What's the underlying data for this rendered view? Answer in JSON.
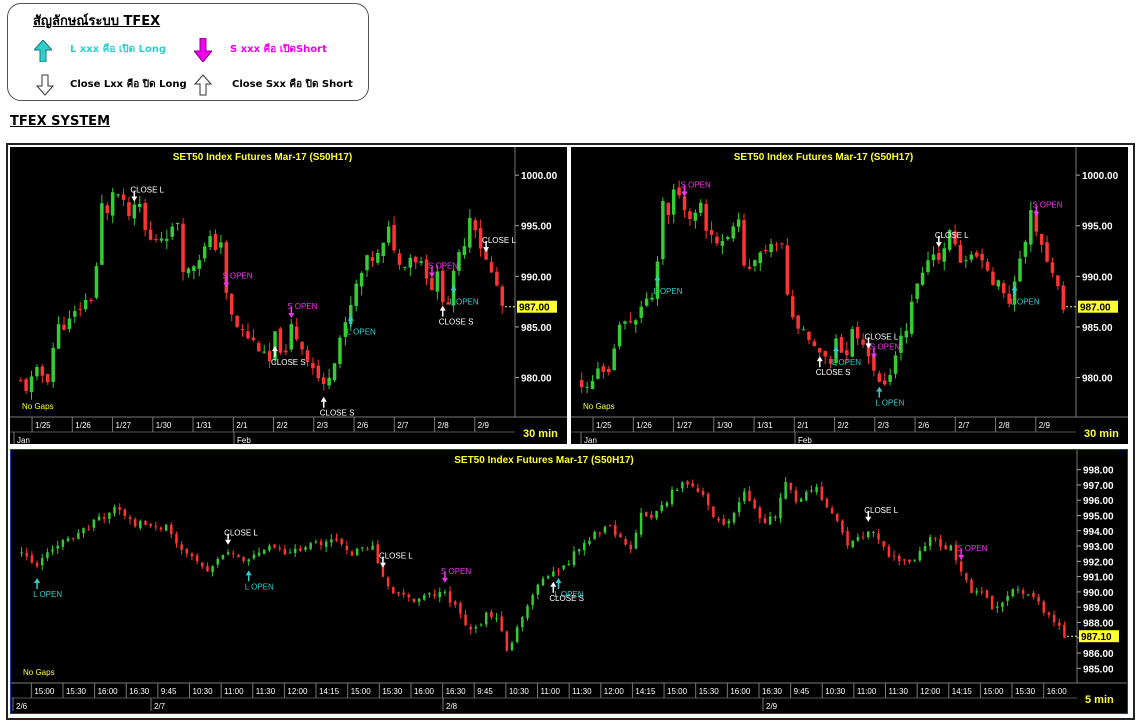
{
  "legend": {
    "title": "สัญลักษณ์ระบบ TFEX",
    "items": [
      {
        "icon": "up-arrow-filled-icon",
        "color": "#33cccc",
        "text": "L xxx คือ เปิด Long"
      },
      {
        "icon": "down-arrow-filled-icon",
        "color": "#ee00ee",
        "text": "S xxx คือ เปิดShort"
      },
      {
        "icon": "down-arrow-outline-icon",
        "color": "#000000",
        "text": "Close Lxx คือ ปิด Long"
      },
      {
        "icon": "up-arrow-outline-icon",
        "color": "#000000",
        "text": "Close Sxx คือ ปิด Short"
      }
    ]
  },
  "heading": "TFEX SYSTEM",
  "colors": {
    "up": "#33cc33",
    "down": "#ff3333",
    "long": "#33cccc",
    "short": "#ee33ee",
    "close": "#ffffff",
    "title": "#ffff33",
    "price": "#ffff33"
  },
  "chart_data": [
    {
      "type": "candlestick",
      "title": "SET50  Index  Futures  Mar-17  (S50H17)",
      "interval": "30  min",
      "gaps": "No  Gaps",
      "last_price": "987.00",
      "y_ticks": [
        "1000.00",
        "995.00",
        "990.00",
        "985.00",
        "980.00"
      ],
      "ylim": [
        976.5,
        1001.0
      ],
      "x_ticks": [
        "1/25",
        "1/26",
        "1/27",
        "1/30",
        "1/31",
        "2/1",
        "2/2",
        "2/3",
        "2/6",
        "2/7",
        "2/8",
        "2/9"
      ],
      "months": [
        "Jan",
        "Feb"
      ],
      "path": [
        [
          0,
          979.5
        ],
        [
          1,
          979
        ],
        [
          3,
          980.5
        ],
        [
          5,
          980
        ],
        [
          6,
          983
        ],
        [
          7,
          985
        ],
        [
          9,
          985.5
        ],
        [
          11,
          987
        ],
        [
          13,
          988
        ],
        [
          14,
          991
        ],
        [
          15,
          997
        ],
        [
          16,
          996
        ],
        [
          17,
          998.5
        ],
        [
          18,
          998
        ],
        [
          20,
          996
        ],
        [
          22,
          997
        ],
        [
          23,
          994.5
        ],
        [
          24,
          993.5
        ],
        [
          26,
          994
        ],
        [
          28,
          994.5
        ],
        [
          29,
          995.5
        ],
        [
          30,
          991
        ],
        [
          31,
          990.5
        ],
        [
          33,
          992
        ],
        [
          35,
          993.5
        ],
        [
          36,
          993
        ],
        [
          37,
          993.5
        ],
        [
          38,
          988
        ],
        [
          39,
          986
        ],
        [
          40,
          985
        ],
        [
          42,
          984
        ],
        [
          44,
          983
        ],
        [
          45,
          982
        ],
        [
          46,
          981.5
        ],
        [
          47,
          984
        ],
        [
          48,
          983
        ],
        [
          49,
          982
        ],
        [
          50,
          985
        ],
        [
          52,
          983
        ],
        [
          54,
          981
        ],
        [
          55,
          980
        ],
        [
          56,
          979
        ],
        [
          57,
          980.5
        ],
        [
          58,
          982
        ],
        [
          59,
          984
        ],
        [
          60,
          985
        ],
        [
          61,
          987
        ],
        [
          62,
          989
        ],
        [
          64,
          991.5
        ],
        [
          66,
          992
        ],
        [
          67,
          993
        ],
        [
          68,
          994.5
        ],
        [
          69,
          993
        ],
        [
          70,
          991
        ],
        [
          72,
          992
        ],
        [
          74,
          991.5
        ],
        [
          76,
          989
        ],
        [
          77,
          990
        ],
        [
          78,
          988
        ],
        [
          79,
          987.5
        ],
        [
          80,
          990
        ],
        [
          81,
          992
        ],
        [
          82,
          993.5
        ],
        [
          83,
          996
        ],
        [
          84,
          995
        ],
        [
          85,
          993
        ],
        [
          86,
          991.5
        ],
        [
          88,
          989
        ],
        [
          89,
          987
        ]
      ],
      "signals": [
        {
          "i": 21,
          "type": "close",
          "label": "CLOSE  L",
          "side": "above"
        },
        {
          "i": 38,
          "type": "short",
          "label": "S  OPEN",
          "side": "above"
        },
        {
          "i": 47,
          "type": "close",
          "label": "CLOSE  S",
          "side": "below"
        },
        {
          "i": 50,
          "type": "short",
          "label": "S  OPEN",
          "side": "above"
        },
        {
          "i": 56,
          "type": "close",
          "label": "CLOSE  S",
          "side": "below"
        },
        {
          "i": 61,
          "type": "long",
          "label": "L  OPEN",
          "side": "below"
        },
        {
          "i": 76,
          "type": "short",
          "label": "S  OPEN",
          "side": "above"
        },
        {
          "i": 78,
          "type": "close",
          "label": "CLOSE  S",
          "side": "below"
        },
        {
          "i": 80,
          "type": "long",
          "label": "L  OPEN",
          "side": "below"
        },
        {
          "i": 86,
          "type": "close",
          "label": "CLOSE  L",
          "side": "above"
        }
      ]
    },
    {
      "type": "candlestick",
      "title": "SET50  Index  Futures  Mar-17  (S50H17)",
      "interval": "30  min",
      "gaps": "No  Gaps",
      "last_price": "987.00",
      "y_ticks": [
        "1000.00",
        "995.00",
        "990.00",
        "985.00",
        "980.00"
      ],
      "ylim": [
        976.5,
        1001.0
      ],
      "x_ticks": [
        "1/25",
        "1/26",
        "1/27",
        "1/30",
        "1/31",
        "2/1",
        "2/2",
        "2/3",
        "2/6",
        "2/7",
        "2/8",
        "2/9"
      ],
      "months": [
        "Jan",
        "Feb"
      ],
      "path": [
        [
          0,
          979.5
        ],
        [
          1,
          979
        ],
        [
          3,
          980.5
        ],
        [
          5,
          980
        ],
        [
          6,
          983
        ],
        [
          7,
          985
        ],
        [
          9,
          985.5
        ],
        [
          11,
          987
        ],
        [
          13,
          988
        ],
        [
          14,
          991
        ],
        [
          15,
          997
        ],
        [
          16,
          996
        ],
        [
          17,
          998.5
        ],
        [
          18,
          998
        ],
        [
          20,
          996
        ],
        [
          22,
          997
        ],
        [
          23,
          994.5
        ],
        [
          24,
          993.5
        ],
        [
          26,
          994
        ],
        [
          28,
          994.5
        ],
        [
          29,
          995.5
        ],
        [
          30,
          991
        ],
        [
          31,
          990.5
        ],
        [
          33,
          992
        ],
        [
          35,
          993.5
        ],
        [
          36,
          993
        ],
        [
          37,
          993.5
        ],
        [
          38,
          988
        ],
        [
          39,
          986
        ],
        [
          40,
          985
        ],
        [
          42,
          984
        ],
        [
          44,
          983
        ],
        [
          45,
          982
        ],
        [
          46,
          981.5
        ],
        [
          47,
          984
        ],
        [
          48,
          983
        ],
        [
          49,
          982
        ],
        [
          50,
          985
        ],
        [
          52,
          983
        ],
        [
          54,
          981
        ],
        [
          55,
          980
        ],
        [
          56,
          979
        ],
        [
          57,
          980.5
        ],
        [
          58,
          982
        ],
        [
          59,
          984
        ],
        [
          60,
          985
        ],
        [
          61,
          987
        ],
        [
          62,
          989
        ],
        [
          64,
          991.5
        ],
        [
          66,
          992
        ],
        [
          67,
          993
        ],
        [
          68,
          994.5
        ],
        [
          69,
          993
        ],
        [
          70,
          991
        ],
        [
          72,
          992
        ],
        [
          74,
          991.5
        ],
        [
          76,
          989
        ],
        [
          77,
          990
        ],
        [
          78,
          988
        ],
        [
          79,
          987.5
        ],
        [
          80,
          990
        ],
        [
          81,
          992
        ],
        [
          82,
          993.5
        ],
        [
          83,
          996
        ],
        [
          84,
          995
        ],
        [
          85,
          993
        ],
        [
          86,
          991.5
        ],
        [
          88,
          989
        ],
        [
          89,
          987
        ]
      ],
      "signals": [
        {
          "i": 14,
          "type": "long",
          "label": "L  OPEN",
          "side": "below"
        },
        {
          "i": 19,
          "type": "close",
          "label": "",
          "side": "above"
        },
        {
          "i": 19,
          "type": "short",
          "label": "S  OPEN",
          "side": "above"
        },
        {
          "i": 44,
          "type": "close",
          "label": "CLOSE  S",
          "side": "below"
        },
        {
          "i": 47,
          "type": "long",
          "label": "L  OPEN",
          "side": "below"
        },
        {
          "i": 53,
          "type": "close",
          "label": "CLOSE  L",
          "side": "above"
        },
        {
          "i": 54,
          "type": "short",
          "label": "S  OPEN",
          "side": "above"
        },
        {
          "i": 55,
          "type": "long",
          "label": "L  OPEN",
          "side": "below"
        },
        {
          "i": 66,
          "type": "close",
          "label": "CLOSE  L",
          "side": "above"
        },
        {
          "i": 80,
          "type": "long",
          "label": "L  OPEN",
          "side": "below"
        },
        {
          "i": 84,
          "type": "short",
          "label": "S  OPEN",
          "side": "above"
        }
      ]
    },
    {
      "type": "candlestick",
      "title": "SET50  Index  Futures  Mar-17  (S50H17)",
      "interval": "5  min",
      "gaps": "No  Gaps",
      "last_price": "987.10",
      "y_ticks": [
        "998.00",
        "997.00",
        "996.00",
        "995.00",
        "994.00",
        "993.00",
        "992.00",
        "991.00",
        "990.00",
        "989.00",
        "988.00",
        "987.00",
        "986.00",
        "985.00"
      ],
      "ylim": [
        984.3,
        998.5
      ],
      "x_ticks": [
        "15:00",
        "15:30",
        "16:00",
        "16:30",
        "9:45",
        "10:30",
        "11:00",
        "11:30",
        "12:00",
        "14:15",
        "15:00",
        "15:30",
        "16:00",
        "16:30",
        "9:45",
        "10:30",
        "11:00",
        "11:30",
        "12:00",
        "14:15",
        "15:00",
        "15:30",
        "16:00",
        "16:30",
        "9:45",
        "10:30",
        "11:00",
        "11:30",
        "12:00",
        "14:15",
        "15:00",
        "15:30",
        "16:00"
      ],
      "months": [
        "2/6",
        "2/7",
        "2/8",
        "2/9"
      ],
      "path": [
        [
          0,
          992.5
        ],
        [
          3,
          991.5
        ],
        [
          6,
          993
        ],
        [
          10,
          993.5
        ],
        [
          14,
          994.5
        ],
        [
          18,
          995.5
        ],
        [
          22,
          994.5
        ],
        [
          26,
          994.3
        ],
        [
          28,
          994.3
        ],
        [
          30,
          993
        ],
        [
          34,
          992
        ],
        [
          36,
          991.5
        ],
        [
          40,
          992.5
        ],
        [
          44,
          992
        ],
        [
          48,
          993
        ],
        [
          52,
          992.5
        ],
        [
          56,
          993
        ],
        [
          60,
          993.5
        ],
        [
          64,
          992.5
        ],
        [
          68,
          993
        ],
        [
          70,
          991
        ],
        [
          72,
          990
        ],
        [
          76,
          989.5
        ],
        [
          80,
          989.8
        ],
        [
          82,
          990
        ],
        [
          84,
          989
        ],
        [
          86,
          988
        ],
        [
          88,
          987.5
        ],
        [
          90,
          988.5
        ],
        [
          92,
          988.5
        ],
        [
          94,
          986
        ],
        [
          96,
          987.5
        ],
        [
          98,
          989
        ],
        [
          100,
          990.5
        ],
        [
          102,
          991
        ],
        [
          104,
          991.5
        ],
        [
          106,
          992
        ],
        [
          108,
          993
        ],
        [
          110,
          993.5
        ],
        [
          112,
          994
        ],
        [
          114,
          994.2
        ],
        [
          116,
          993.5
        ],
        [
          118,
          993
        ],
        [
          120,
          995
        ],
        [
          122,
          995
        ],
        [
          124,
          995.5
        ],
        [
          126,
          996.5
        ],
        [
          128,
          997
        ],
        [
          130,
          997
        ],
        [
          132,
          996.5
        ],
        [
          134,
          995
        ],
        [
          136,
          994.5
        ],
        [
          138,
          995
        ],
        [
          140,
          996.5
        ],
        [
          142,
          995.5
        ],
        [
          144,
          994.5
        ],
        [
          146,
          995
        ],
        [
          148,
          997
        ],
        [
          150,
          996
        ],
        [
          152,
          996.5
        ],
        [
          154,
          997
        ],
        [
          156,
          995.5
        ],
        [
          158,
          994.5
        ],
        [
          160,
          993
        ],
        [
          162,
          993.5
        ],
        [
          164,
          994
        ],
        [
          166,
          993.5
        ],
        [
          168,
          992.5
        ],
        [
          170,
          992
        ],
        [
          172,
          991.8
        ],
        [
          174,
          992.5
        ],
        [
          176,
          993.5
        ],
        [
          178,
          993
        ],
        [
          180,
          993
        ],
        [
          182,
          991.5
        ],
        [
          184,
          990
        ],
        [
          186,
          990
        ],
        [
          188,
          989
        ],
        [
          190,
          989.5
        ],
        [
          192,
          990
        ],
        [
          194,
          990
        ],
        [
          196,
          989.5
        ],
        [
          198,
          988.8
        ],
        [
          200,
          988
        ],
        [
          202,
          987.2
        ]
      ],
      "signals": [
        {
          "i": 3,
          "type": "long",
          "label": "L  OPEN",
          "side": "below"
        },
        {
          "i": 40,
          "type": "close",
          "label": "CLOSE  L",
          "side": "above"
        },
        {
          "i": 44,
          "type": "long",
          "label": "L  OPEN",
          "side": "below"
        },
        {
          "i": 70,
          "type": "close",
          "label": "CLOSE  L",
          "side": "above"
        },
        {
          "i": 82,
          "type": "short",
          "label": "S  OPEN",
          "side": "above"
        },
        {
          "i": 103,
          "type": "close",
          "label": "CLOSE  S",
          "side": "below"
        },
        {
          "i": 104,
          "type": "long",
          "label": "L  OPEN",
          "side": "below"
        },
        {
          "i": 164,
          "type": "close",
          "label": "CLOSE  L",
          "side": "above"
        },
        {
          "i": 182,
          "type": "short",
          "label": "S  OPEN",
          "side": "above"
        }
      ]
    }
  ]
}
